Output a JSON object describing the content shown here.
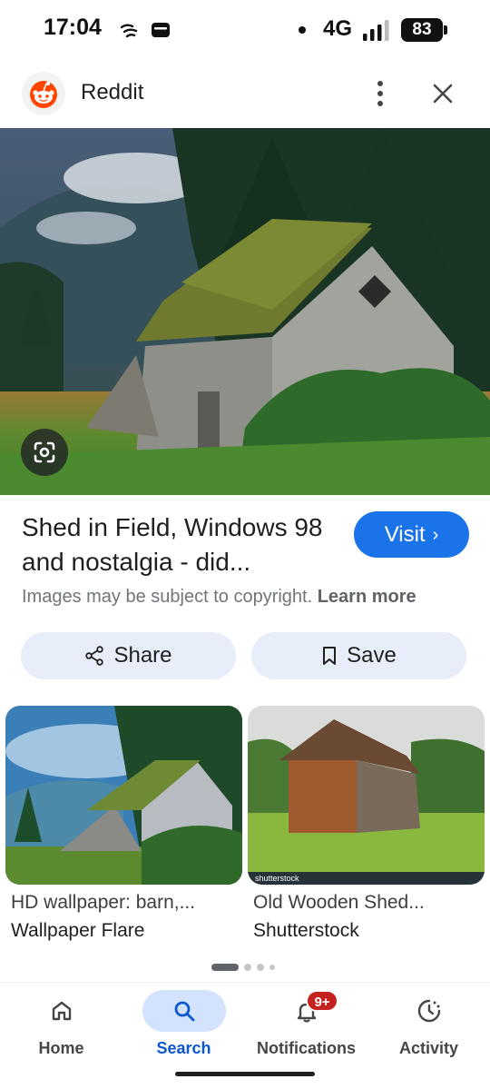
{
  "status_bar": {
    "time": "17:04",
    "network": "4G",
    "battery": "83",
    "icons": [
      "wind-icon",
      "wallet-icon",
      "signal-icon",
      "battery-icon"
    ]
  },
  "header": {
    "site_name": "Reddit",
    "logo_icon": "reddit-logo",
    "more_icon": "more-vert-icon",
    "close_icon": "close-icon"
  },
  "result": {
    "title": "Shed in Field, Windows 98 and nostalgia - did...",
    "visit_label": "Visit",
    "copyright_text": "Images may be subject to copyright.",
    "learn_more": "Learn more"
  },
  "actions": {
    "share_label": "Share",
    "save_label": "Save"
  },
  "related": [
    {
      "title": "HD wallpaper: barn,...",
      "source": "Wallpaper Flare"
    },
    {
      "title": "Old Wooden Shed...",
      "source": "Shutterstock",
      "watermark": "shutterstock"
    }
  ],
  "pager": {
    "total": 4,
    "active": 1
  },
  "nav": {
    "items": [
      {
        "label": "Home",
        "icon": "home-icon"
      },
      {
        "label": "Search",
        "icon": "search-icon",
        "active": true
      },
      {
        "label": "Notifications",
        "icon": "bell-icon",
        "badge": "9+"
      },
      {
        "label": "Activity",
        "icon": "activity-icon"
      }
    ]
  },
  "colors": {
    "accent": "#1a73e8",
    "active_nav": "#0b57d0",
    "pill_bg": "#e8eef9",
    "badge": "#c5221f"
  }
}
